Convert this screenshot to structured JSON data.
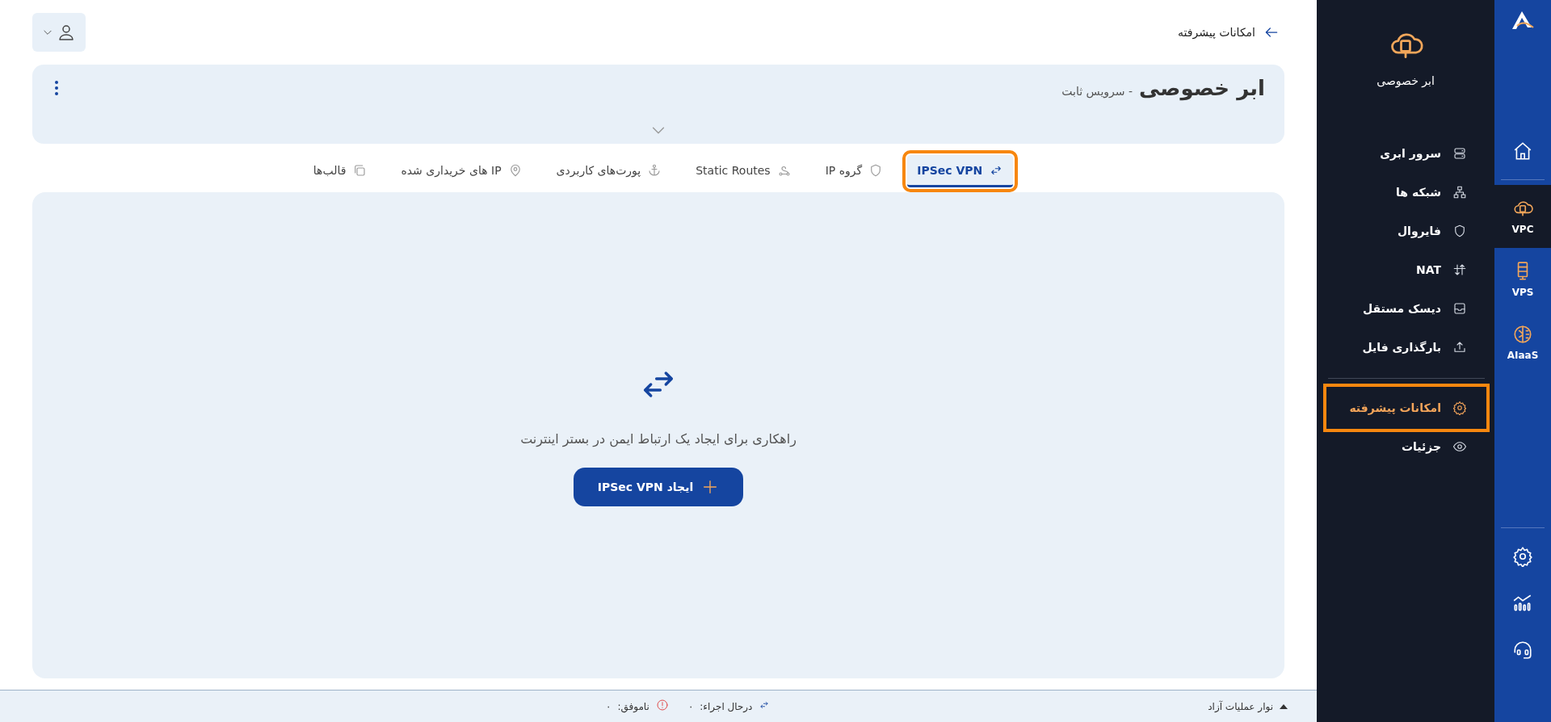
{
  "header": {
    "breadcrumb": "امکانات پیشرفته"
  },
  "service_card": {
    "title": "ابر خصوصی",
    "subtitle": "- سرویس ثابت"
  },
  "tabs": [
    {
      "label": "IPSec VPN",
      "selected": true,
      "highlighted": true
    },
    {
      "label": "گروه IP",
      "selected": false,
      "highlighted": false
    },
    {
      "label": "Static Routes",
      "selected": false,
      "highlighted": false
    },
    {
      "label": "پورت‌های کاربردی",
      "selected": false,
      "highlighted": false
    },
    {
      "label": "IP های خریداری شده",
      "selected": false,
      "highlighted": false
    },
    {
      "label": "قالب‌ها",
      "selected": false,
      "highlighted": false
    }
  ],
  "empty_state": {
    "message": "راهکاری برای ایجاد یک ارتباط ایمن در بستر اینترنت",
    "button": "ایجاد IPSec VPN"
  },
  "status_bar": {
    "toggle": "نوار عملیات آزاد",
    "running_label": "درحال اجراء:",
    "running_count": "۰",
    "failed_label": "ناموفق:",
    "failed_count": "۰"
  },
  "sidebar": {
    "title": "ابر خصوصی",
    "groups": [
      [
        {
          "label": "سرور ابری",
          "selected": false,
          "highlighted": false
        },
        {
          "label": "شبکه ها",
          "selected": false,
          "highlighted": false
        },
        {
          "label": "فایروال",
          "selected": false,
          "highlighted": false
        },
        {
          "label": "NAT",
          "selected": false,
          "highlighted": false
        },
        {
          "label": "دیسک مستقل",
          "selected": false,
          "highlighted": false
        },
        {
          "label": "بارگذاری فایل",
          "selected": false,
          "highlighted": false
        }
      ],
      [
        {
          "label": "امکانات پیشرفته",
          "selected": true,
          "highlighted": true
        },
        {
          "label": "جزئیات",
          "selected": false,
          "highlighted": false
        }
      ]
    ]
  },
  "rail": {
    "items": [
      {
        "label": "VPC",
        "selected": true
      },
      {
        "label": "VPS",
        "selected": false
      },
      {
        "label": "AIaaS",
        "selected": false
      }
    ]
  }
}
